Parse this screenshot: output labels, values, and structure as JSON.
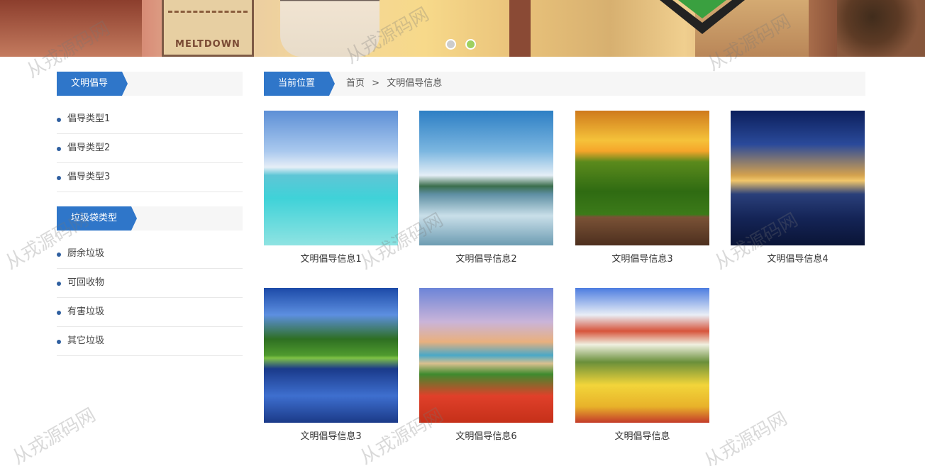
{
  "banner": {
    "sign_text": "MELTDOWN",
    "slides": [
      {
        "active": false
      },
      {
        "active": true
      }
    ],
    "colors": {
      "dot_inactive": "#cccccc",
      "dot_active": "#9ed060"
    }
  },
  "sidebar": {
    "sections": [
      {
        "title": "文明倡导",
        "items": [
          "倡导类型1",
          "倡导类型2",
          "倡导类型3"
        ]
      },
      {
        "title": "垃圾袋类型",
        "items": [
          "厨余垃圾",
          "可回收物",
          "有害垃圾",
          "其它垃圾"
        ]
      }
    ]
  },
  "breadcrumb": {
    "label": "当前位置",
    "home": "首页",
    "separator": ">",
    "current": "文明倡导信息"
  },
  "gallery": {
    "items": [
      {
        "caption": "文明倡导信息1",
        "image": "tropical-sea-photo"
      },
      {
        "caption": "文明倡导信息2",
        "image": "lake-sky-photo"
      },
      {
        "caption": "文明倡导信息3",
        "image": "sunset-forest-photo"
      },
      {
        "caption": "文明倡导信息4",
        "image": "night-beach-photo"
      },
      {
        "caption": "文明倡导信息3",
        "image": "tree-reflection-photo"
      },
      {
        "caption": "文明倡导信息6",
        "image": "coastal-painting"
      },
      {
        "caption": "文明倡导信息",
        "image": "village-painting"
      }
    ]
  },
  "watermark": "从戎源码网",
  "colors": {
    "accent": "#2f76c9",
    "bullet": "#2f5fa0",
    "panel_bg": "#f6f6f6"
  }
}
